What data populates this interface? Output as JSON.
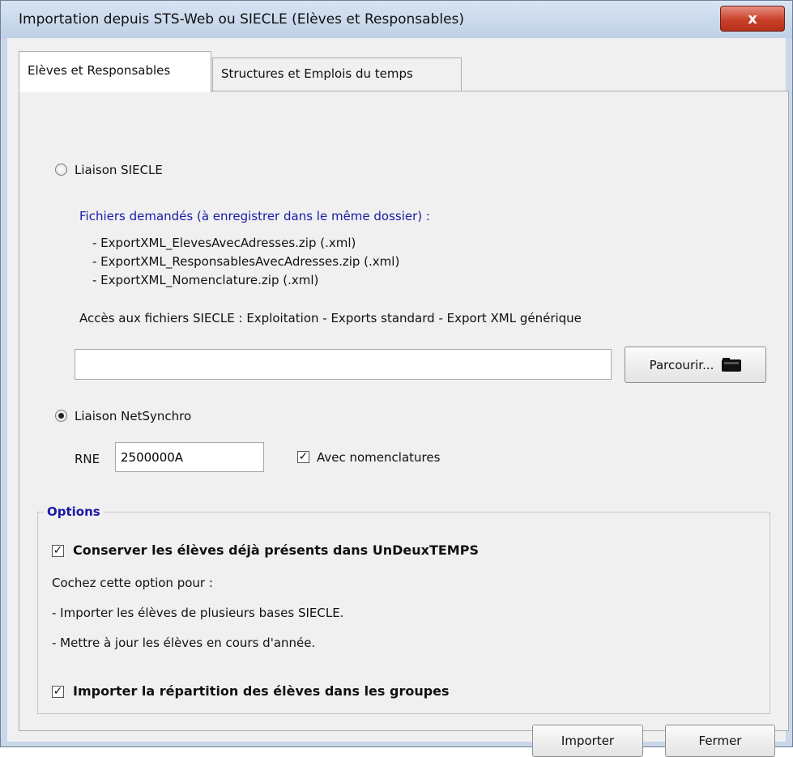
{
  "window": {
    "title": "Importation depuis STS-Web ou SIECLE (Elèves et Responsables)",
    "close_glyph": "x"
  },
  "tabs": [
    {
      "label": "Elèves et Responsables",
      "active": true
    },
    {
      "label": "Structures et Emplois du temps",
      "active": false
    }
  ],
  "siecle": {
    "radio_label": "Liaison SIECLE",
    "files_header": "Fichiers demandés (à enregistrer dans le même dossier) :",
    "files": [
      "- ExportXML_ElevesAvecAdresses.zip (.xml)",
      "- ExportXML_ResponsablesAvecAdresses.zip (.xml)",
      "- ExportXML_Nomenclature.zip  (.xml)"
    ],
    "access_text": "Accès aux fichiers SIECLE : Exploitation - Exports standard - Export XML générique",
    "path_value": "",
    "browse_label": "Parcourir..."
  },
  "netsynchro": {
    "radio_label": "Liaison NetSynchro",
    "selected": true,
    "rne_label": "RNE",
    "rne_value": "2500000A",
    "nomenclatures_label": "Avec nomenclatures",
    "nomenclatures_checked": true,
    "check_glyph": "✓"
  },
  "options": {
    "title": "Options",
    "keep_label": "Conserver les élèves déjà présents dans UnDeuxTEMPS",
    "keep_checked": true,
    "hint_intro": "Cochez cette option pour :",
    "hint_lines": [
      "- Importer les élèves de plusieurs bases SIECLE.",
      "- Mettre à jour les élèves en cours d'année."
    ],
    "groups_label": "Importer la répartition des élèves dans les groupes",
    "groups_checked": true
  },
  "buttons": {
    "import_label": "Importer",
    "close_label": "Fermer"
  }
}
